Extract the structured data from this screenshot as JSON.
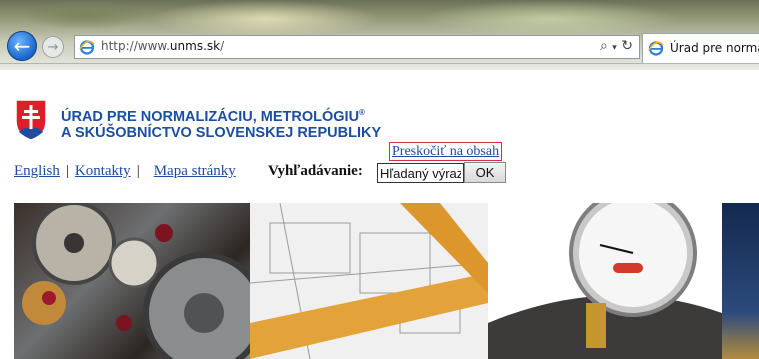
{
  "browser": {
    "url_prefix": "http://www.",
    "url_domain": "unms.sk",
    "url_suffix": "/",
    "tab_title": "Úrad pre normalizá",
    "back_icon": "arrow-left-icon",
    "forward_icon": "arrow-right-icon",
    "search_icon": "magnifier-icon",
    "refresh_icon": "refresh-icon"
  },
  "header": {
    "org_line1": "ÚRAD PRE NORMALIZÁCIU, METROLÓGIU",
    "org_mark": "®",
    "org_line2": "A SKÚŠOBNÍCTVO SLOVENSKEJ REPUBLIKY",
    "skip_link": "Preskočiť na obsah"
  },
  "nav": {
    "items": [
      {
        "label": "English"
      },
      {
        "label": "Kontakty"
      },
      {
        "label": "Mapa stránky"
      }
    ],
    "separator": "|",
    "search_label": "Vyhľadávanie:",
    "search_value": "Hľadaný výraz",
    "ok_label": "OK"
  },
  "colors": {
    "link": "#1d4ba0",
    "org_text": "#1b4ea0",
    "skip_border": "#d83040"
  }
}
